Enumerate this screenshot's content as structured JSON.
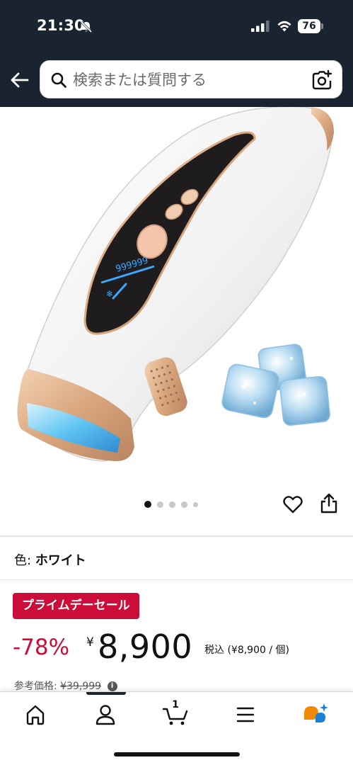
{
  "status_bar": {
    "time": "21:30",
    "battery": "76"
  },
  "search": {
    "placeholder": "検索または質問する"
  },
  "product": {
    "color_label": "色:",
    "color_value": "ホワイト",
    "deal_badge": "プライムデーセール",
    "discount": "-78%",
    "currency": "¥",
    "price": "8,900",
    "tax_info": "税込 (¥8,900 / 個)",
    "ref_label": "参考価格:",
    "ref_price": "¥39,999",
    "device_display": "999999"
  },
  "carousel": {
    "count": 5,
    "active_index": 0
  },
  "bottom_nav": {
    "cart_count": "1"
  },
  "colors": {
    "header": "#1a2430",
    "deal": "#cc0c39",
    "accent": "#f08804"
  }
}
